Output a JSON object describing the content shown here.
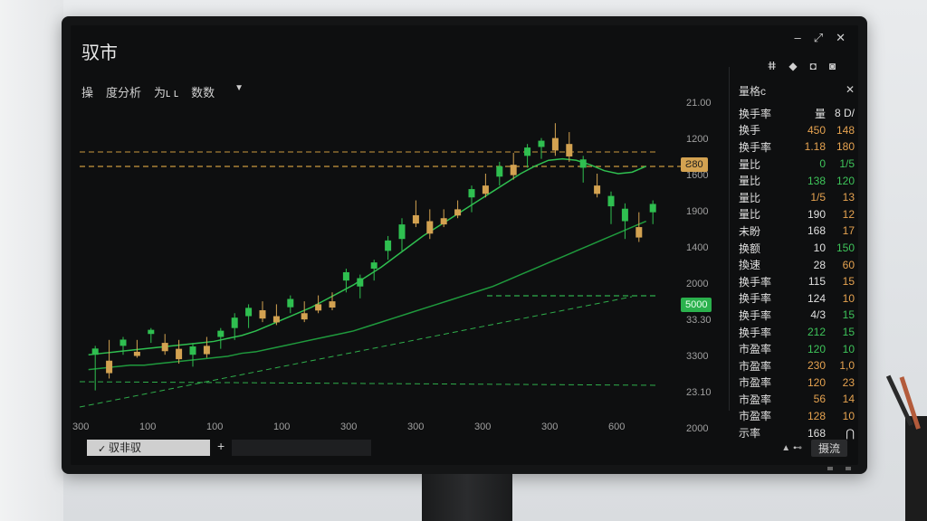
{
  "app": {
    "title": "驭市"
  },
  "window": {
    "min": "–",
    "restore": "⤢",
    "close": "✕"
  },
  "toolbar": {
    "items": [
      "操",
      "度分析",
      "为ʟ ʟ",
      "数数"
    ],
    "dropdown": "▼"
  },
  "panel": {
    "title": "量格c",
    "close": "✕",
    "icons": [
      "ⵌ",
      "◆",
      "◘",
      "◙"
    ],
    "rows": [
      {
        "label": "换手率",
        "v1": "量",
        "v2": "8 D/",
        "c1": "#e0e0e0",
        "c2": "#e0e0e0"
      },
      {
        "label": "换手",
        "v1": "450",
        "v2": "148",
        "c1": "#e6a350",
        "c2": "#e6a350"
      },
      {
        "label": "换手率",
        "v1": "1.18",
        "v2": "180",
        "c1": "#e6a350",
        "c2": "#e6a350"
      },
      {
        "label": "量比",
        "v1": "0",
        "v2": "1/5",
        "c1": "#3ec45a",
        "c2": "#3ec45a"
      },
      {
        "label": "量比",
        "v1": "138",
        "v2": "120",
        "c1": "#3ec45a",
        "c2": "#3ec45a"
      },
      {
        "label": "量比",
        "v1": "1/5",
        "v2": "13",
        "c1": "#e6a350",
        "c2": "#e6a350"
      },
      {
        "label": "量比",
        "v1": "190",
        "v2": "12",
        "c1": "#e0e0e0",
        "c2": "#e6a350"
      },
      {
        "label": "未盼",
        "v1": "168",
        "v2": "17",
        "c1": "#e0e0e0",
        "c2": "#e6a350"
      },
      {
        "label": "换额",
        "v1": "10",
        "v2": "150",
        "c1": "#e0e0e0",
        "c2": "#3ec45a"
      },
      {
        "label": "換速",
        "v1": "28",
        "v2": "60",
        "c1": "#e0e0e0",
        "c2": "#e6a350"
      },
      {
        "label": "换手率",
        "v1": "115",
        "v2": "15",
        "c1": "#e0e0e0",
        "c2": "#e6a350"
      },
      {
        "label": "换手率",
        "v1": "124",
        "v2": "10",
        "c1": "#e0e0e0",
        "c2": "#e6a350"
      },
      {
        "label": "换手率",
        "v1": "4/3",
        "v2": "15",
        "c1": "#e0e0e0",
        "c2": "#3ec45a"
      },
      {
        "label": "换手率",
        "v1": "212",
        "v2": "15",
        "c1": "#3ec45a",
        "c2": "#3ec45a"
      },
      {
        "label": "市盈率",
        "v1": "120",
        "v2": "10",
        "c1": "#3ec45a",
        "c2": "#3ec45a"
      },
      {
        "label": "市盈率",
        "v1": "230",
        "v2": "1,0",
        "c1": "#e6a350",
        "c2": "#e6a350"
      },
      {
        "label": "市盈率",
        "v1": "120",
        "v2": "23",
        "c1": "#e6a350",
        "c2": "#e6a350"
      },
      {
        "label": "市盈率",
        "v1": "56",
        "v2": "14",
        "c1": "#e6a350",
        "c2": "#e6a350"
      },
      {
        "label": "市盈率",
        "v1": "128",
        "v2": "10",
        "c1": "#e6a350",
        "c2": "#e6a350"
      },
      {
        "label": "示率",
        "v1": "168",
        "v2": "⋂",
        "c1": "#e0e0e0",
        "c2": "#e0e0e0"
      }
    ]
  },
  "tabs": {
    "active": "驭非驭",
    "check": "✓",
    "add": "+"
  },
  "status": {
    "icons": "▲ ⊷",
    "button": "摄流"
  },
  "chart_data": {
    "type": "candlestick",
    "y_ticks": [
      "21.00",
      "1200",
      "1600",
      "1900",
      "1400",
      "2000",
      "33.30",
      "3300",
      "23.10",
      "2000"
    ],
    "x_ticks": [
      "300",
      "100",
      "100",
      "100",
      "300",
      "300",
      "300",
      "300",
      "600"
    ],
    "price_tags": [
      {
        "text": "Ƨ80",
        "color": "#d3a251"
      },
      {
        "text": "5000",
        "color": "#2bb14d"
      }
    ],
    "candles": [
      [
        1,
        1,
        54,
        60,
        30,
        "g"
      ],
      [
        2,
        2,
        50,
        64,
        38,
        "o"
      ],
      [
        3,
        2,
        60,
        66,
        54,
        "g"
      ],
      [
        4,
        2,
        56,
        64,
        52,
        "o"
      ],
      [
        5,
        3,
        68,
        72,
        62,
        "g"
      ],
      [
        6,
        3,
        62,
        68,
        54,
        "o"
      ],
      [
        7,
        3,
        58,
        64,
        48,
        "o"
      ],
      [
        8,
        4,
        54,
        62,
        46,
        "g"
      ],
      [
        9,
        4,
        60,
        66,
        52,
        "o"
      ],
      [
        10,
        4,
        66,
        72,
        58,
        "g"
      ],
      [
        11,
        5,
        72,
        82,
        64,
        "g"
      ],
      [
        12,
        5,
        80,
        88,
        72,
        "g"
      ],
      [
        13,
        5,
        84,
        90,
        76,
        "o"
      ],
      [
        14,
        6,
        80,
        88,
        74,
        "o"
      ],
      [
        15,
        6,
        86,
        94,
        82,
        "g"
      ],
      [
        16,
        7,
        82,
        90,
        76,
        "o"
      ],
      [
        17,
        7,
        88,
        94,
        82,
        "o"
      ],
      [
        18,
        7,
        90,
        96,
        84,
        "o"
      ],
      [
        19,
        8,
        104,
        112,
        96,
        "g"
      ],
      [
        20,
        8,
        100,
        108,
        92,
        "g"
      ],
      [
        21,
        9,
        112,
        118,
        104,
        "g"
      ],
      [
        22,
        9,
        124,
        134,
        118,
        "g"
      ],
      [
        23,
        10,
        132,
        146,
        124,
        "g"
      ],
      [
        24,
        10,
        148,
        158,
        140,
        "o"
      ],
      [
        25,
        11,
        144,
        152,
        132,
        "o"
      ],
      [
        26,
        11,
        146,
        152,
        140,
        "o"
      ],
      [
        27,
        12,
        152,
        158,
        146,
        "o"
      ],
      [
        28,
        12,
        160,
        168,
        150,
        "g"
      ],
      [
        29,
        13,
        168,
        176,
        160,
        "o"
      ],
      [
        30,
        13,
        174,
        184,
        168,
        "g"
      ],
      [
        31,
        14,
        182,
        190,
        172,
        "o"
      ],
      [
        32,
        14,
        188,
        196,
        180,
        "g"
      ],
      [
        33,
        14,
        194,
        200,
        186,
        "g"
      ],
      [
        34,
        15,
        200,
        210,
        188,
        "o"
      ],
      [
        35,
        15,
        196,
        204,
        184,
        "o"
      ],
      [
        36,
        16,
        180,
        188,
        170,
        "g"
      ],
      [
        37,
        16,
        168,
        176,
        160,
        "o"
      ],
      [
        38,
        17,
        154,
        164,
        142,
        "g"
      ],
      [
        39,
        17,
        144,
        156,
        132,
        "g"
      ],
      [
        40,
        18,
        140,
        150,
        130,
        "o"
      ],
      [
        41,
        18,
        150,
        158,
        142,
        "g"
      ]
    ],
    "ma_short": [
      54,
      55,
      56,
      57,
      58,
      59,
      60,
      61,
      62,
      63,
      65,
      67,
      70,
      74,
      78,
      82,
      86,
      91,
      96,
      101,
      107,
      113,
      120,
      127,
      134,
      140,
      146,
      152,
      158,
      164,
      170,
      176,
      181,
      185,
      186,
      185,
      182,
      178,
      176,
      177,
      181
    ],
    "ma_long": [
      44,
      45,
      46,
      47,
      47,
      48,
      49,
      50,
      51,
      52,
      53,
      55,
      56,
      58,
      60,
      62,
      64,
      66,
      68,
      70,
      73,
      76,
      79,
      82,
      85,
      88,
      91,
      94,
      97,
      100,
      104,
      108,
      112,
      116,
      120,
      124,
      128,
      132,
      136,
      140,
      144
    ]
  }
}
